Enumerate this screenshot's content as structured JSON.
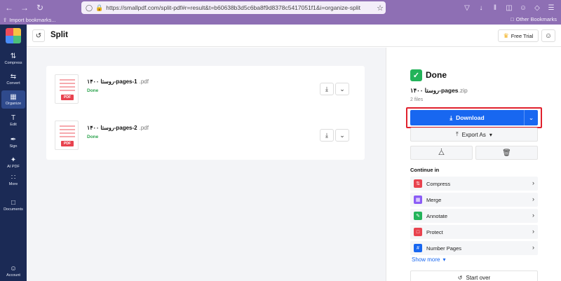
{
  "browser": {
    "url": "https://smallpdf.com/split-pdf#r=result&t=b60638b3d5c6ba8f9d8378c5417051f1&i=organize-split",
    "bookmarks_left": "Import bookmarks...",
    "bookmarks_right": "Other Bookmarks"
  },
  "sidebar": {
    "items": [
      {
        "label": "Compress",
        "icon": "compress-icon"
      },
      {
        "label": "Convert",
        "icon": "convert-icon"
      },
      {
        "label": "Organize",
        "icon": "organize-icon"
      },
      {
        "label": "Edit",
        "icon": "edit-icon"
      },
      {
        "label": "Sign",
        "icon": "sign-icon"
      },
      {
        "label": "AI PDF",
        "icon": "ai-pdf-icon"
      },
      {
        "label": "More",
        "icon": "more-icon"
      },
      {
        "label": "Documents",
        "icon": "documents-icon"
      },
      {
        "label": "Account",
        "icon": "account-icon"
      }
    ]
  },
  "header": {
    "title": "Split",
    "trial_label": "Free Trial"
  },
  "files": [
    {
      "name": "روستا ۱۴۰۰-pages-1",
      "ext": ".pdf",
      "status": "Done",
      "badge": "PDF"
    },
    {
      "name": "روستا ۱۴۰۰-pages-2",
      "ext": ".pdf",
      "status": "Done",
      "badge": "PDF"
    }
  ],
  "result": {
    "done_label": "Done",
    "zip_name": "روستا ۱۴۰۰-pages",
    "zip_ext": ".zip",
    "file_count": "2 files",
    "download_label": "Download",
    "export_label": "Export As",
    "continue_label": "Continue in",
    "continue_items": [
      {
        "label": "Compress",
        "color": "#e8424e"
      },
      {
        "label": "Merge",
        "color": "#8b5cf6"
      },
      {
        "label": "Annotate",
        "color": "#23b35a"
      },
      {
        "label": "Protect",
        "color": "#e8424e"
      },
      {
        "label": "Number Pages",
        "color": "#1867f0"
      }
    ],
    "show_more_label": "Show more",
    "start_over_label": "Start over"
  },
  "colors": {
    "accent": "#1867f0",
    "sidebar": "#1b2a55",
    "success": "#23b35a",
    "highlight": "#e0212d"
  }
}
